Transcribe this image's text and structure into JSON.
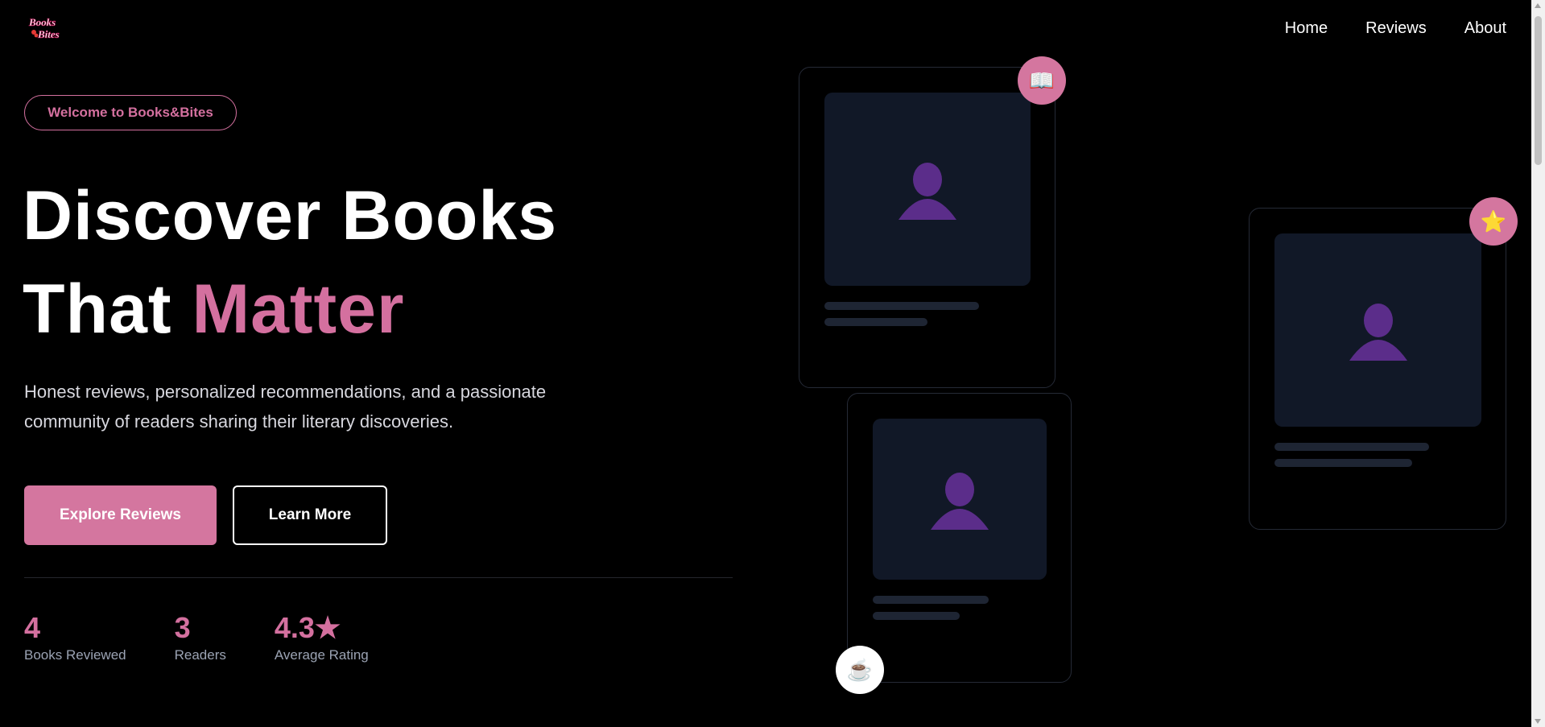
{
  "header": {
    "logo_line1": "Books",
    "logo_line2": "Bites",
    "nav": [
      {
        "label": "Home"
      },
      {
        "label": "Reviews"
      },
      {
        "label": "About"
      }
    ]
  },
  "hero": {
    "welcome": "Welcome to Books&Bites",
    "headline_line1": "Discover Books",
    "headline_line2_prefix": "That ",
    "headline_line2_accent": "Matter",
    "subtitle_line1": "Honest reviews, personalized recommendations, and a passionate",
    "subtitle_line2": "community of readers sharing their literary discoveries.",
    "primary_button": "Explore Reviews",
    "secondary_button": "Learn More"
  },
  "stats": [
    {
      "value": "4",
      "label": "Books Reviewed"
    },
    {
      "value": "3",
      "label": "Readers"
    },
    {
      "value": "4.3★",
      "label": "Average Rating"
    }
  ],
  "cards": {
    "badges": {
      "book": "📖",
      "star": "⭐",
      "coffee": "☕"
    },
    "icon_names": [
      "person-silhouette-icon",
      "book-icon",
      "star-icon",
      "coffee-icon"
    ]
  },
  "colors": {
    "accent": "#d4709f",
    "background": "#000000",
    "card_image": "#111827",
    "silhouette": "#5b2d8a"
  }
}
